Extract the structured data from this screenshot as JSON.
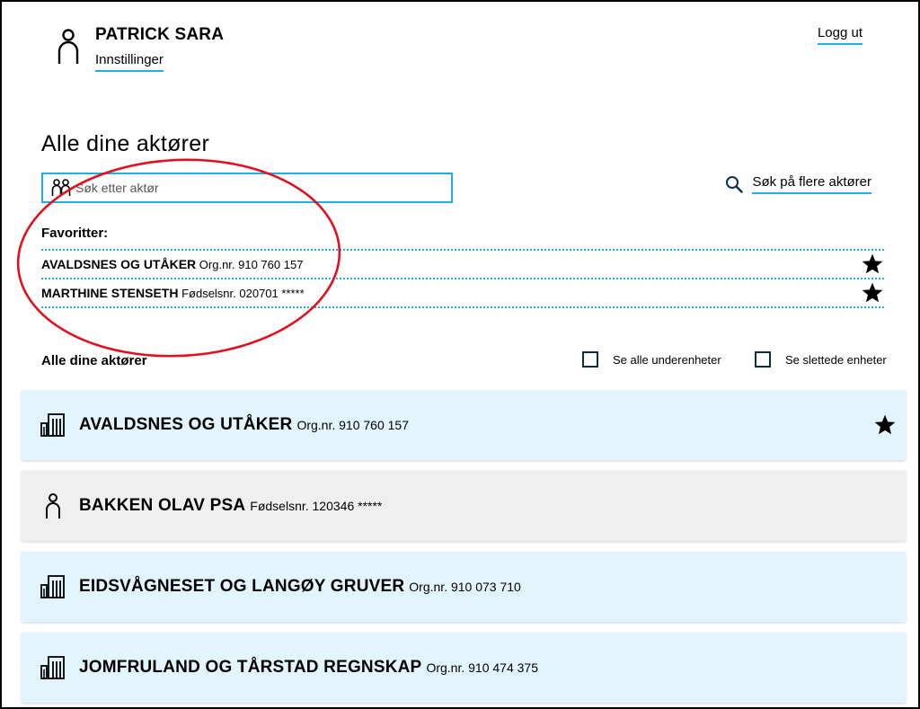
{
  "header": {
    "user_name": "PATRICK SARA",
    "settings_label": "Innstillinger",
    "logout_label": "Logg ut"
  },
  "page_title": "Alle dine aktører",
  "search": {
    "placeholder": "Søk etter aktør",
    "more_label": "Søk på flere aktører"
  },
  "favorites": {
    "title": "Favoritter:",
    "items": [
      {
        "name": "AVALDSNES OG UTÅKER",
        "id": "Org.nr. 910 760 157",
        "starred": true
      },
      {
        "name": "MARTHINE STENSETH",
        "id": "Fødselsnr. 020701 *****",
        "starred": true
      }
    ]
  },
  "all_actors": {
    "title": "Alle dine aktører",
    "show_subunits_label": "Se alle underenheter",
    "show_deleted_label": "Se slettede enheter",
    "items": [
      {
        "type": "org",
        "icon": "building-icon",
        "name": "AVALDSNES OG UTÅKER",
        "id": "Org.nr. 910 760 157",
        "starred": true
      },
      {
        "type": "person",
        "icon": "person-icon",
        "name": "BAKKEN OLAV PSA",
        "id": "Fødselsnr. 120346 *****",
        "starred": false
      },
      {
        "type": "org",
        "icon": "building-icon",
        "name": "EIDSVÅGNESET OG LANGØY GRUVER",
        "id": "Org.nr. 910 073 710",
        "starred": false
      },
      {
        "type": "org",
        "icon": "building-icon",
        "name": "JOMFRULAND OG TÅRSTAD REGNSKAP",
        "id": "Org.nr. 910 474 375",
        "starred": false
      }
    ]
  },
  "colors": {
    "accent": "#1eaee8",
    "org_card_bg": "#e3f5fc",
    "person_card_bg": "#efefef",
    "annotation": "#e0101e"
  }
}
